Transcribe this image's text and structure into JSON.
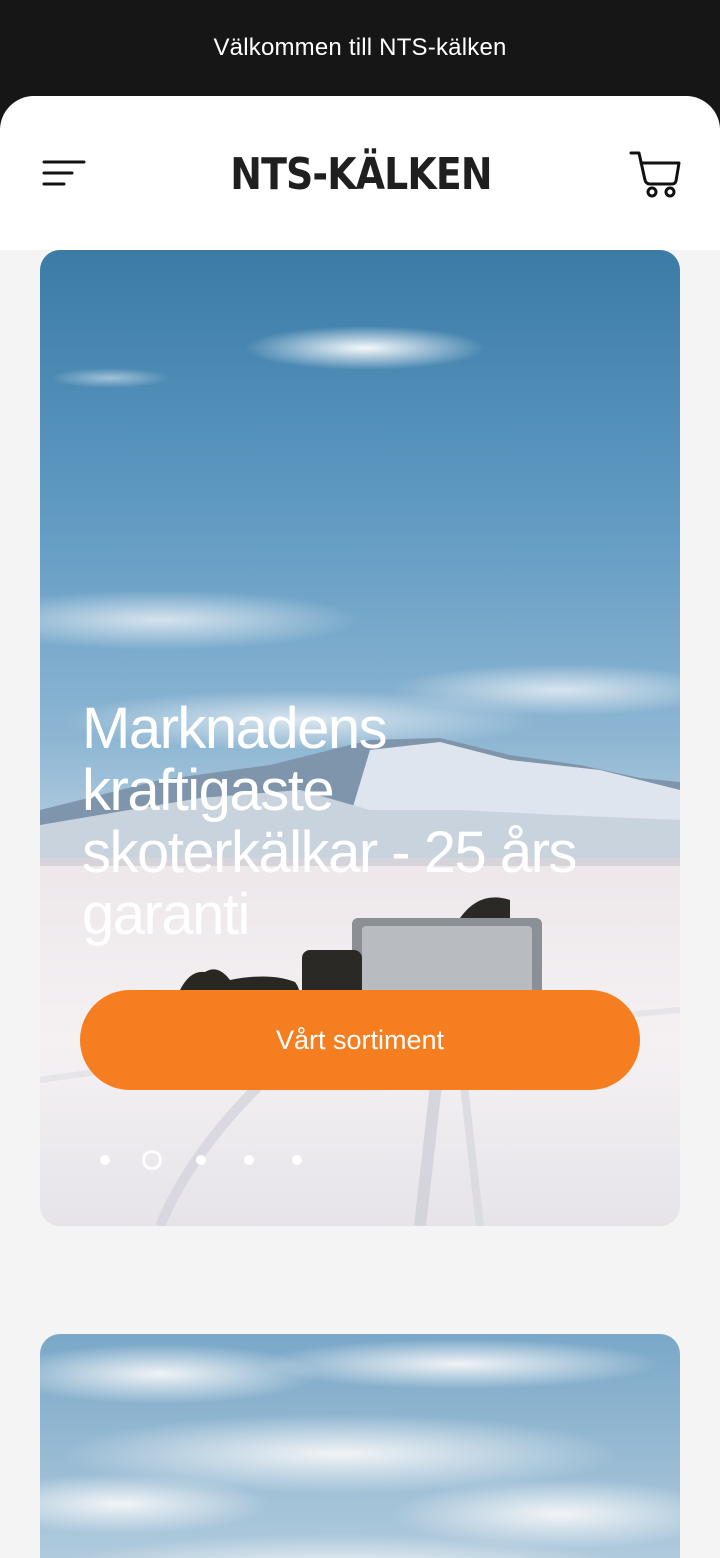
{
  "announcement": {
    "text": "Välkommen till NTS-kälken"
  },
  "header": {
    "logo_text": "NTS-KÄLKEN",
    "menu_icon": "hamburger-menu-icon",
    "cart_icon": "shopping-cart-icon"
  },
  "hero": {
    "title": "Marknadens kraftigaste skoterkälkar - 25 års garanti",
    "cta_label": "Vårt sortiment",
    "slide_count": 5,
    "active_slide": 2
  },
  "colors": {
    "announcement_bg": "#161616",
    "accent": "#f47e20",
    "page_bg": "#f4f4f4"
  }
}
